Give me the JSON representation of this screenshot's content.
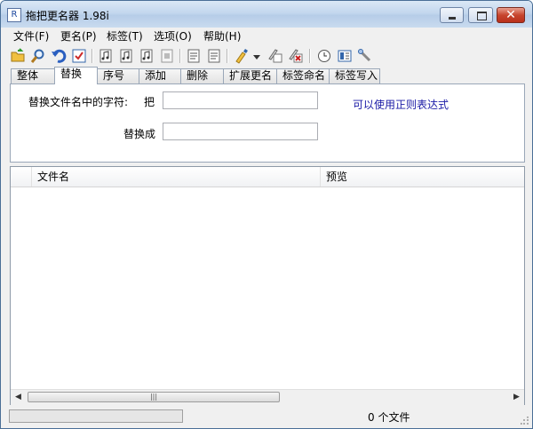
{
  "window": {
    "title": "拖把更名器 1.98i"
  },
  "menu": [
    "文件(F)",
    "更名(P)",
    "标签(T)",
    "选项(O)",
    "帮助(H)"
  ],
  "toolbar_icons": [
    "open-folder-icon",
    "search-icon",
    "undo-icon",
    "apply-icon",
    "music-tag-icon",
    "music-tag-2-icon",
    "music-tag-3-icon",
    "doc-tag-icon",
    "text-file-icon",
    "text-file-2-icon",
    "paint-brush-icon",
    "dropdown-arrow-icon",
    "edit-icon",
    "delete-icon",
    "clock-icon",
    "panel-icon",
    "tools-icon"
  ],
  "tabs": [
    "整体",
    "替换",
    "序号",
    "添加",
    "删除",
    "扩展更名",
    "标签命名",
    "标签写入"
  ],
  "active_tab": "替换",
  "replace_panel": {
    "find_label": "替换文件名中的字符:",
    "find_prefix": "把",
    "find_value": "",
    "replace_label": "替换成",
    "replace_value": "",
    "regex_hint": "可以使用正则表达式"
  },
  "list": {
    "columns": [
      "文件名",
      "预览"
    ],
    "rows": []
  },
  "scrollbar": {
    "thumb_glyph": "|||"
  },
  "status": {
    "file_count_text": "0 个文件",
    "progress": 0
  },
  "colors": {
    "title_gradient": "#c3d7ee",
    "hint": "#1a1aa6",
    "close": "#c7452e"
  }
}
